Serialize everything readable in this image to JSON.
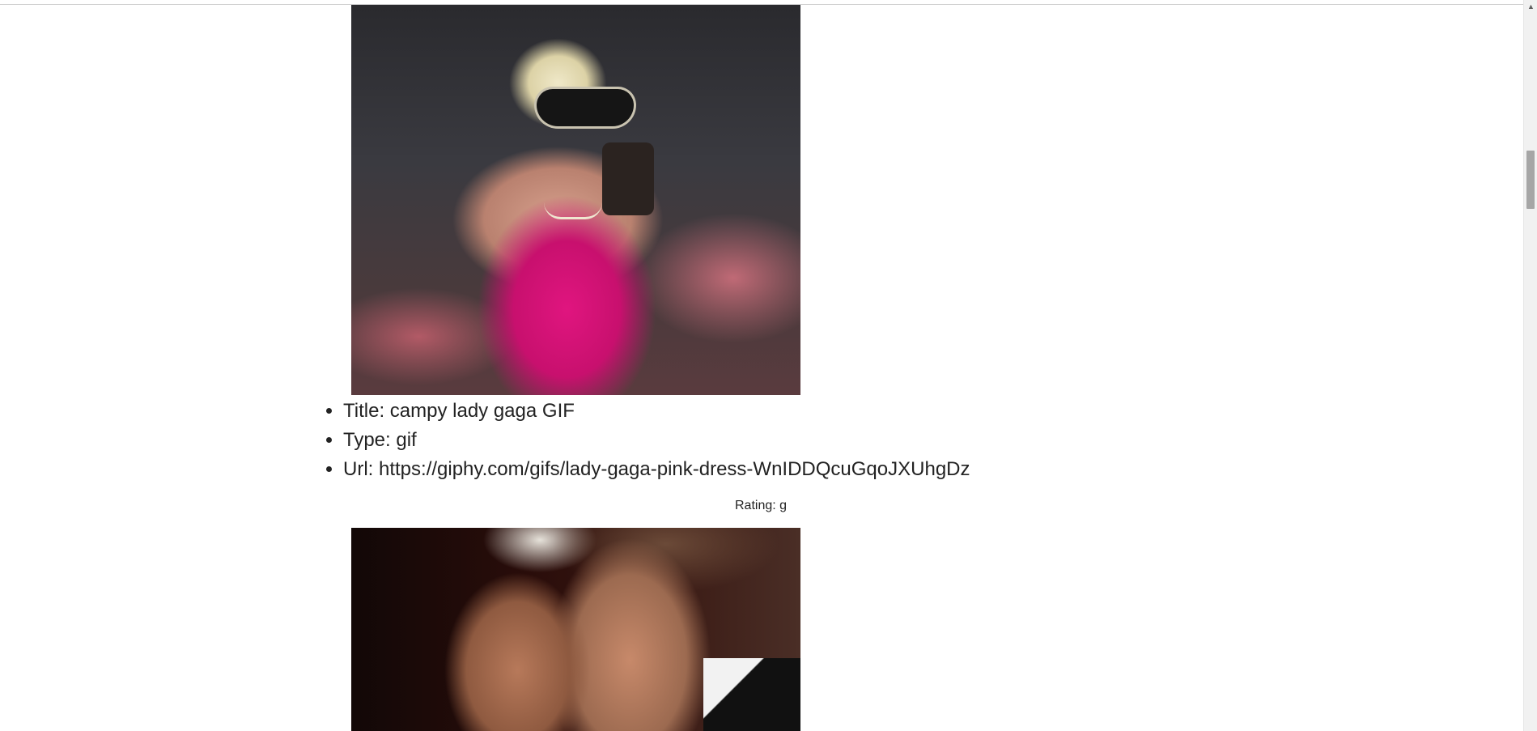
{
  "results": [
    {
      "image_alt": "campy lady gaga GIF",
      "title_label": "Title: campy lady gaga GIF",
      "type_label": "Type: gif",
      "url_label": "Url: https://giphy.com/gifs/lady-gaga-pink-dress-WnIDDQcuGqoJXUhgDz",
      "rating_label": "Rating: g"
    }
  ],
  "scrollbar": {
    "up_arrow_icon": "triangle-up"
  }
}
